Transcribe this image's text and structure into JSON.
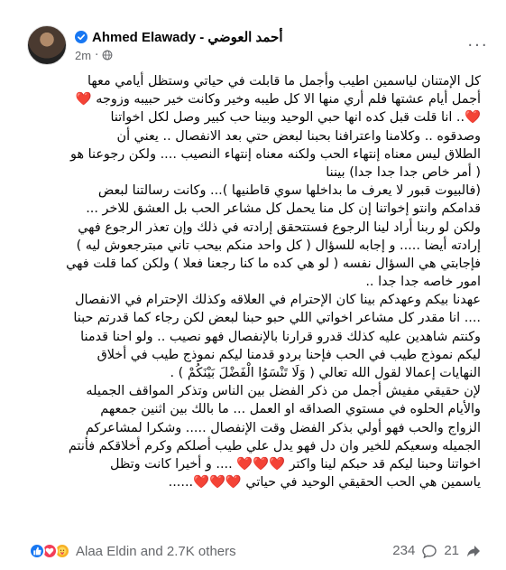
{
  "post": {
    "author": "Ahmed Elawady - أحمد العوضي",
    "time": "2m",
    "separator": "·",
    "icons": {
      "verified": "verified-badge-icon",
      "privacy": "globe-icon",
      "more": "more-options-icon"
    },
    "more_label": "···",
    "lines": [
      "كل الإمتنان  لياسمين اطيب وأجمل  ما قابلت في حياتي  وستظل أيامي  معها",
      "أجمل  أيام عشتها  فلم أري  منها الا كل طيبه وخير وكانت خير حبيبه وزوجه ❤️",
      "❤️.. انا قلت قبل كده انها حبي  الوحيد وبينا حب كبير وصل لكل اخواتنا",
      "وصدقوه .. وكلامنا واعترافنا بحبنا  لبعض حتي بعد الانفصال ..  يعني أن",
      "الطلاق ليس معناه إنتهاء  الحب ولكنه معناه إنتهاء النصيب .... ولكن رجوعنا هو",
      "( أمر  خاص جدا جدا جدا)  بيننا",
      "(فالبيوت قبور لا يعرف ما بداخلها سوي قاطنيها )...  وكانت رسالتنا لبعض",
      "قدامكم  وانتو إخواتنا إن  كل منا يحمل كل مشاعر الحب بل العشق للاخر ...",
      "ولكن لو ربنا أراد لينا الرجوع فستتحقق إرادته  في ذلك وإن تعذر الرجوع فهي",
      "إرادته  أيضا  ..... و إجابه للسؤال ( كل واحد منكم بيحب تاني مبترجعوش ليه )",
      "فإجابتي هي السؤال نفسه ( لو هي كده ما كنا رجعنا فعلا ) ولكن كما قلت فهي",
      "امور  خاصه جدا جدا ..",
      "عهدنا بيكم وعهدكم بينا كان الإحترام  في العلاقه وكذلك الإحترام في الانفصال",
      "....  انا مقدر كل مشاعر اخواتي اللي حبو حبنا لبعض لكن رجاء كما قدرتم حبنا",
      "وكنتم شاهدين عليه كذلك قدرو قرارنا بالإنفصال فهو نصيب .. ولو احنا قدمنا",
      "ليكم  نموذج طيب في الحب فإحنا  بردو قدمنا ليكم نموذج طيب في أخلاق",
      "النهايات  إعمالا لقول الله تعالي ( وَلَا تَنْسَوُا الْفَضْلَ بَيْنَكُمْ ) .",
      "لإن حقيقي مفيش أجمل من ذكر الفضل بين الناس وتذكر المواقف الجميله",
      "والأيام الحلوه في مستوي الصداقه او العمل ... ما بالك بين اثنين جمعهم",
      "الزواج والحب فهو أولي بذكر الفضل وقت الإنفصال ..... وشكرا لمشاعركم",
      "الجميله وسعيكم للخير وان دل فهو يدل علي طيب أصلكم  وكرم أخلاقكم  فأنتم",
      "اخواتنا وحبنا ليكم قد حبكم لينا واكتر ❤️❤️❤️ .... و أخيرا  كانت وتظل",
      "ياسمين هي الحب الحقيقي الوحيد  في حياتي  ❤️❤️❤️......"
    ]
  },
  "footer": {
    "reaction_icons": [
      "like-icon",
      "love-icon",
      "care-icon"
    ],
    "reactions_text": "Alaa Eldin and 2.7K others",
    "comments_count": "234",
    "shares_count": "21",
    "comment_icon": "comment-icon",
    "share_icon": "share-icon"
  }
}
